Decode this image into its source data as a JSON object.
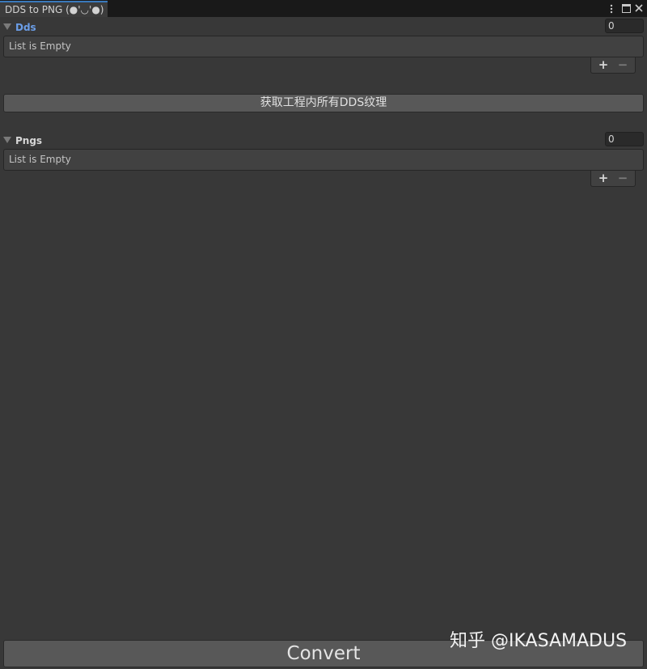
{
  "window": {
    "tab_title": "DDS to PNG (●'◡'●)",
    "menu_icon": "kebab-menu-icon",
    "maximize_icon": "maximize-icon",
    "close_icon": "close-icon"
  },
  "dds_section": {
    "label": "Dds",
    "size": "0",
    "empty_text": "List is Empty",
    "add_label": "+",
    "remove_label": "−",
    "label_color": "#6b9ee8"
  },
  "scan_button": {
    "label": "获取工程内所有DDS纹理"
  },
  "pngs_section": {
    "label": "Pngs",
    "size": "0",
    "empty_text": "List is Empty",
    "add_label": "+",
    "remove_label": "−",
    "label_color": "#d6d6d6"
  },
  "convert_button": {
    "label": "Convert"
  },
  "watermark": {
    "text": "知乎 @IKASAMADUS"
  }
}
